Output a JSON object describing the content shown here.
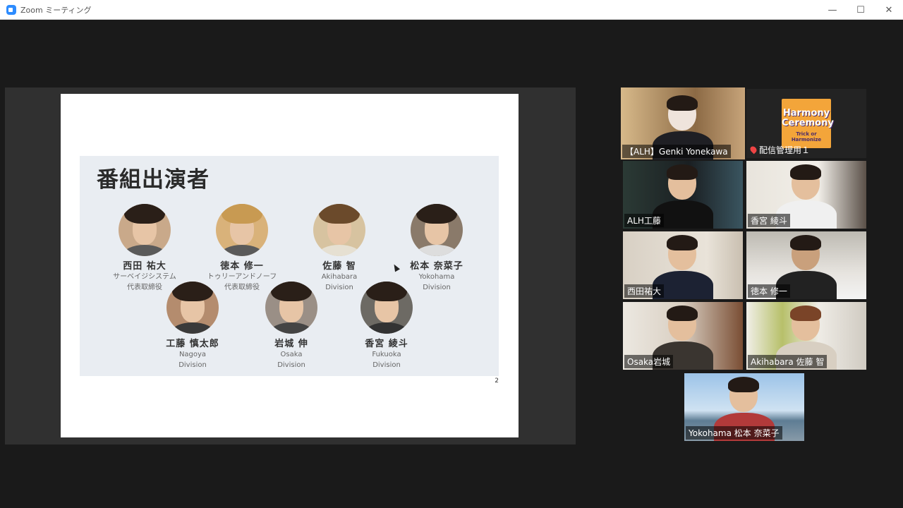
{
  "window": {
    "title": "Zoom ミーティング",
    "minimize": "—",
    "maximize": "☐",
    "close": "✕"
  },
  "slide": {
    "title": "番組出演者",
    "page_number": "2",
    "cast": [
      {
        "name": "西田 祐大",
        "line1": "サーベイジシステム",
        "line2": "代表取締役"
      },
      {
        "name": "徳本 修一",
        "line1": "トゥリーアンドノーフ",
        "line2": "代表取締役"
      },
      {
        "name": "佐藤 智",
        "line1": "Akihabara",
        "line2": "Division"
      },
      {
        "name": "松本 奈菜子",
        "line1": "Yokohama",
        "line2": "Division"
      },
      {
        "name": "工藤 慎太郎",
        "line1": "Nagoya",
        "line2": "Division"
      },
      {
        "name": "岩城 伸",
        "line1": "Osaka",
        "line2": "Division"
      },
      {
        "name": "香宮 綾斗",
        "line1": "Fukuoka",
        "line2": "Division"
      }
    ]
  },
  "gallery": {
    "logo_line1": "Harmony",
    "logo_line2": "Ceremony",
    "logo_tagline": "Trick or Harmonize",
    "participants": [
      {
        "label": "【ALH】Genki Yonekawa"
      },
      {
        "label": "配信管理用１"
      },
      {
        "label": "ALH工藤"
      },
      {
        "label": "香宮 綾斗"
      },
      {
        "label": "西田祐大"
      },
      {
        "label": "徳本 修一"
      },
      {
        "label": "Osaka岩城"
      },
      {
        "label": "Akihabara 佐藤 智"
      },
      {
        "label": "Yokohama 松本 奈菜子"
      }
    ]
  },
  "colors": {
    "active_speaker": "#d6e24a",
    "zoom_blue": "#2d8cff"
  }
}
